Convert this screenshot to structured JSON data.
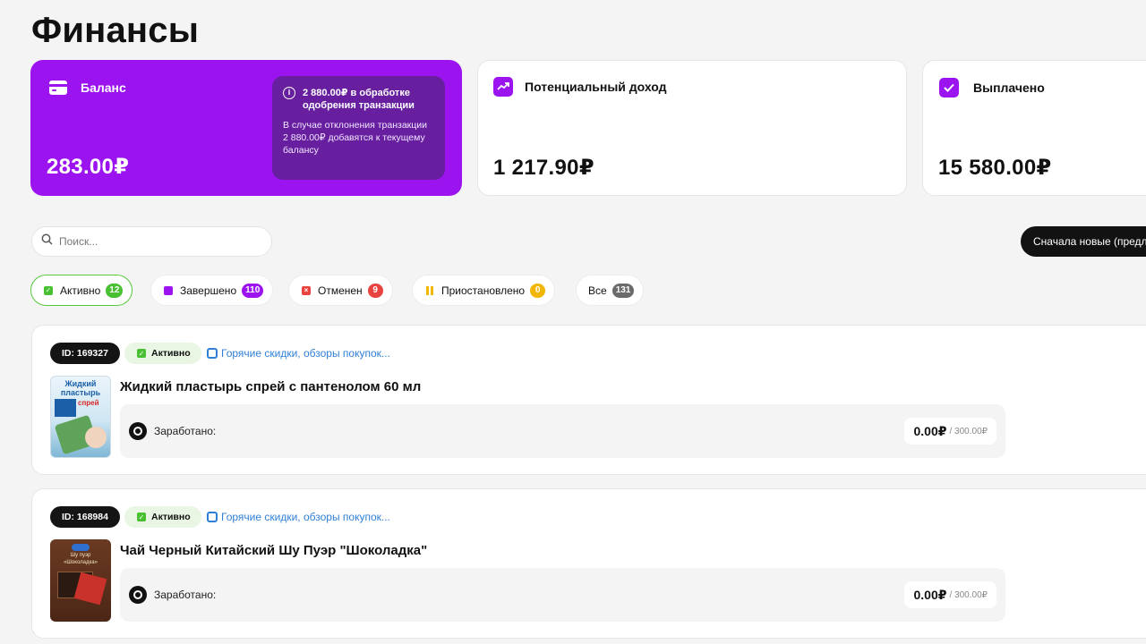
{
  "page": {
    "title": "Финансы"
  },
  "cards": {
    "balance": {
      "label": "Баланс",
      "amount": "283.00₽",
      "pending_title": "2 880.00₽ в обработке одобрения транзакции",
      "pending_text": "В случае отклонения транзакции 2 880.00₽ добавятся к текущему балансу",
      "color": "#9b14f0"
    },
    "potential": {
      "label": "Потенциальный доход",
      "amount": "1 217.90₽"
    },
    "paid": {
      "label": "Выплачено",
      "amount": "15 580.00₽"
    }
  },
  "search": {
    "placeholder": "Поиск..."
  },
  "sort": {
    "label": "Сначала новые (предл"
  },
  "filters": [
    {
      "label": "Активно",
      "count": "12",
      "color": "#48c032"
    },
    {
      "label": "Завершено",
      "count": "110",
      "color": "#9b14f0"
    },
    {
      "label": "Отменен",
      "count": "9",
      "color": "#e8433f"
    },
    {
      "label": "Приостановлено",
      "count": "0",
      "color": "#f2b705"
    },
    {
      "label": "Все",
      "count": "131",
      "color": "#6b6b6b"
    }
  ],
  "orders": [
    {
      "id": "ID: 169327",
      "status": "Активно",
      "channel": "Горячие скидки, обзоры покупок...",
      "name": "Жидкий пластырь спрей с пантенолом 60 мл",
      "earned_label": "Заработано:",
      "earned": "0.00₽",
      "max": "/ 300.00₽",
      "thumb_text": [
        "Жидкий",
        "пластырь",
        "спрей"
      ]
    },
    {
      "id": "ID: 168984",
      "status": "Активно",
      "channel": "Горячие скидки, обзоры покупок...",
      "name": "Чай Черный Китайский Шу Пуэр \"Шоколадка\"",
      "earned_label": "Заработано:",
      "earned": "0.00₽",
      "max": "/ 300.00₽",
      "thumb_text": [
        "Шу пуэр",
        "«Шоколадка»"
      ]
    }
  ]
}
